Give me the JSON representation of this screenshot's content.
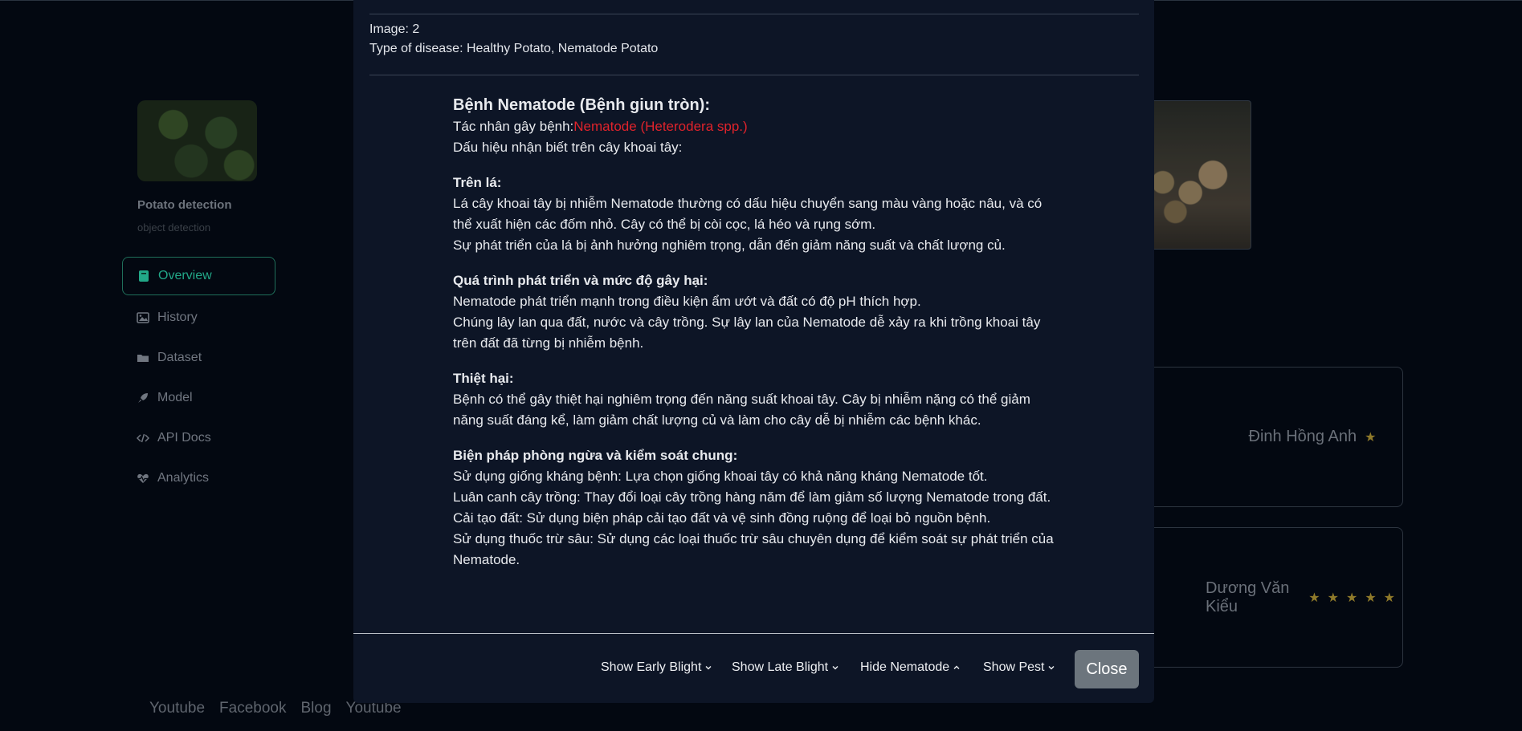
{
  "sidebar": {
    "app_name": "Potato detection",
    "app_subtitle": "object detection",
    "items": [
      {
        "label": "Overview",
        "icon": "book-icon"
      },
      {
        "label": "History",
        "icon": "image-icon"
      },
      {
        "label": "Dataset",
        "icon": "folder-icon"
      },
      {
        "label": "Model",
        "icon": "rocket-icon"
      },
      {
        "label": "API Docs",
        "icon": "code-icon"
      },
      {
        "label": "Analytics",
        "icon": "heart-pulse-icon"
      }
    ]
  },
  "footer_links": [
    "Youtube",
    "Facebook",
    "Blog",
    "Youtube"
  ],
  "reviews": [
    {
      "name": "Đinh Hồng Anh",
      "stars": "★"
    },
    {
      "name": "Dương Văn Kiểu",
      "stars": "★★★★★"
    }
  ],
  "colors": {
    "accent": "#22a888",
    "disease_red": "#e0232b",
    "modal_bg": "#0d1526",
    "close_button": "#6c757d"
  },
  "modal": {
    "image_line": "Image: 2",
    "disease_line": "Type of disease: Healthy Potato, Nematode Potato",
    "title": "Bệnh Nematode (Bệnh giun tròn):",
    "agent_prefix": "Tác nhân gây bệnh:",
    "agent_name": "Nematode (Heterodera spp.)",
    "signs_intro": "Dấu hiệu nhận biết trên cây khoai tây:",
    "leaf_heading": "Trên lá:",
    "leaf_text_1": "Lá cây khoai tây bị nhiễm Nematode thường có dấu hiệu chuyển sang màu vàng hoặc nâu, và có thể xuất hiện các đốm nhỏ. Cây có thể bị còi cọc, lá héo và rụng sớm.",
    "leaf_text_2": "Sự phát triển của lá bị ảnh hưởng nghiêm trọng, dẫn đến giảm năng suất và chất lượng củ.",
    "growth_heading": "Quá trình phát triển và mức độ gây hại:",
    "growth_text_1": "Nematode phát triển mạnh trong điều kiện ẩm ướt và đất có độ pH thích hợp.",
    "growth_text_2": "Chúng lây lan qua đất, nước và cây trồng. Sự lây lan của Nematode dễ xảy ra khi trồng khoai tây trên đất đã từng bị nhiễm bệnh.",
    "damage_heading": "Thiệt hại:",
    "damage_text": "Bệnh có thể gây thiệt hại nghiêm trọng đến năng suất khoai tây. Cây bị nhiễm nặng có thể giảm năng suất đáng kể, làm giảm chất lượng củ và làm cho cây dễ bị nhiễm các bệnh khác.",
    "control_heading": "Biện pháp phòng ngừa và kiểm soát chung:",
    "control_1": "Sử dụng giống kháng bệnh: Lựa chọn giống khoai tây có khả năng kháng Nematode tốt.",
    "control_2": "Luân canh cây trồng: Thay đổi loại cây trồng hàng năm để làm giảm số lượng Nematode trong đất.",
    "control_3": "Cải tạo đất: Sử dụng biện pháp cải tạo đất và vệ sinh đồng ruộng để loại bỏ nguồn bệnh.",
    "control_4": "Sử dụng thuốc trừ sâu: Sử dụng các loại thuốc trừ sâu chuyên dụng để kiểm soát sự phát triển của Nematode.",
    "buttons": {
      "early_blight": "Show Early Blight",
      "late_blight": "Show Late Blight",
      "nematode": "Hide Nematode",
      "pest": "Show Pest",
      "close": "Close"
    }
  }
}
